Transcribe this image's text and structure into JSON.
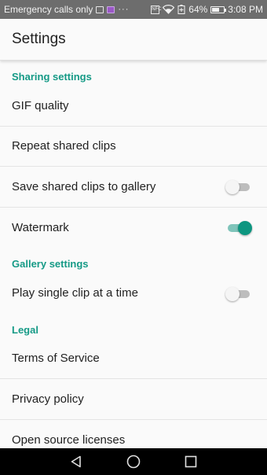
{
  "status_bar": {
    "carrier_text": "Emergency calls only",
    "overflow": "···",
    "nfc_label": "NFC",
    "battery_percent": "64%",
    "battery_level": 0.64,
    "time": "3:08 PM"
  },
  "app_bar": {
    "title": "Settings"
  },
  "sections": {
    "sharing": {
      "title": "Sharing settings",
      "gif_quality": "GIF quality",
      "repeat_clips": "Repeat shared clips",
      "save_to_gallery": "Save shared clips to gallery",
      "save_to_gallery_on": false,
      "watermark": "Watermark",
      "watermark_on": true
    },
    "gallery": {
      "title": "Gallery settings",
      "single_clip": "Play single clip at a time",
      "single_clip_on": false
    },
    "legal": {
      "title": "Legal",
      "terms": "Terms of Service",
      "privacy": "Privacy policy",
      "licenses": "Open source licenses"
    }
  },
  "colors": {
    "accent": "#159a86",
    "status_bar": "#6d6d6d",
    "nav_bar": "#000000"
  },
  "nav": {
    "back_icon": "back-triangle-icon",
    "home_icon": "home-circle-icon",
    "recents_icon": "recents-square-icon"
  }
}
